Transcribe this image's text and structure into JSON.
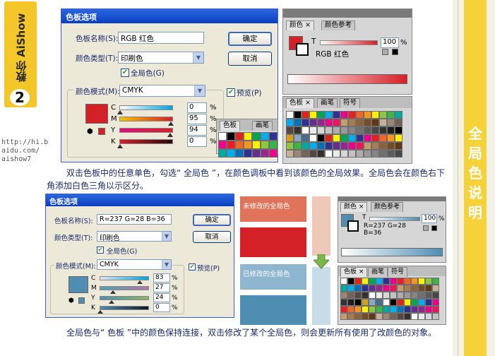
{
  "side": {
    "brand": "AiShow",
    "badge_prefix": "教你",
    "number": "2",
    "url_lines": [
      "http://hi.b",
      "aidu.com/",
      "aishow7"
    ],
    "right_title_chars": [
      "全",
      "局",
      "色",
      "说",
      "明"
    ]
  },
  "dialog1": {
    "title": "色板选项",
    "name_label": "色板名称(S):",
    "name_value": "RGB 红色",
    "type_label": "颜色类型(T):",
    "type_value": "印刷色",
    "global_label": "全局色(G)",
    "mode_label": "颜色模式(M):",
    "mode_value": "CMYK",
    "ok": "确定",
    "cancel": "取消",
    "preview": "预览(P)",
    "channels": [
      {
        "label": "C",
        "value": "0"
      },
      {
        "label": "M",
        "value": "95"
      },
      {
        "label": "Y",
        "value": "94"
      },
      {
        "label": "K",
        "value": "0"
      }
    ],
    "pct": "%"
  },
  "dialog2": {
    "title": "色板选项",
    "name_label": "色板名称(S):",
    "name_value": "R=237 G=28 B=36",
    "type_label": "颜色类型(T):",
    "type_value": "印刷色",
    "global_label": "全局色(G)",
    "mode_label": "颜色模式(M):",
    "mode_value": "CMYK",
    "ok": "确定",
    "cancel": "取消",
    "preview": "预览(P)",
    "channels": [
      {
        "label": "C",
        "value": "83"
      },
      {
        "label": "M",
        "value": "27"
      },
      {
        "label": "Y",
        "value": "24"
      },
      {
        "label": "K",
        "value": "0"
      }
    ],
    "pct": "%"
  },
  "color_panel1": {
    "tabs": [
      "颜色",
      "颜色参考"
    ],
    "t_label": "T",
    "t_value": "100",
    "pct": "%",
    "name": "RGB 红色",
    "swatch_color": "#d42027"
  },
  "color_panel2": {
    "tabs": [
      "颜色",
      "颜色参考"
    ],
    "t_label": "T",
    "t_value": "100",
    "pct": "%",
    "rgb_lines": [
      "R=237 G=28",
      "B=36"
    ],
    "swatch_color": "#4f8db3"
  },
  "swatch_panel1": {
    "tabs": [
      "色板",
      "画笔",
      "符号"
    ]
  },
  "swatch_panel2": {
    "tabs": [
      "色板",
      "画笔",
      "符号"
    ]
  },
  "mini_tabs": [
    "色板",
    "画笔"
  ],
  "captions": {
    "cap1": "双击色板中的任意单色，勾选“ 全局色 ”，在颜色调板中看到该颜色的全局效果。全局色会在颜色右下角添加白色三角以示区分。",
    "cap2": "全局色与“ 色板 ”中的颜色保持连接，双击修改了某个全局色，则会更新所有使用了改颜色的对象。"
  },
  "compare": {
    "before_label": "未修改的全局色",
    "after_label": "已修改的全局色",
    "before_color": "#e0745a",
    "after_color": "#4f8db3"
  }
}
